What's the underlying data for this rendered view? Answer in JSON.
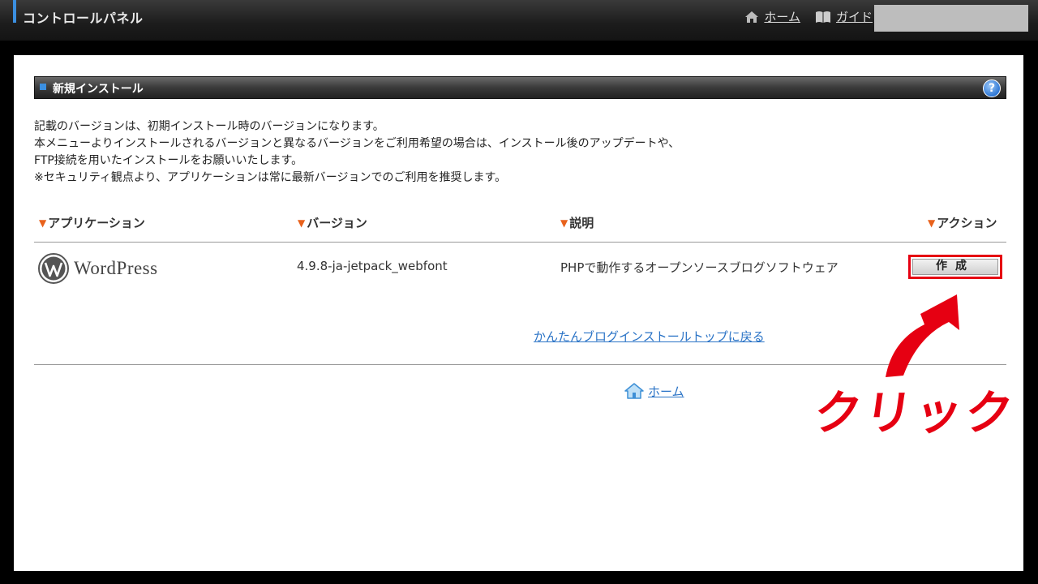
{
  "header": {
    "title": "コントロールパネル",
    "nav": [
      {
        "label": "ホーム",
        "icon": "home-icon"
      },
      {
        "label": "ガイド",
        "icon": "book-icon"
      }
    ]
  },
  "section": {
    "title": "新規インストール",
    "help_label": "?",
    "description": [
      "記載のバージョンは、初期インストール時のバージョンになります。",
      "本メニューよりインストールされるバージョンと異なるバージョンをご利用希望の場合は、インストール後のアップデートや、",
      "FTP接続を用いたインストールをお願いいたします。",
      "※セキュリティ観点より、アプリケーションは常に最新バージョンでのご利用を推奨します。"
    ]
  },
  "table": {
    "sort_marker": "▼",
    "columns": [
      "アプリケーション",
      "バージョン",
      "説明",
      "アクション"
    ],
    "rows": [
      {
        "app_logo_text": "WordPress",
        "version": "4.9.8-ja-jetpack_webfont",
        "description": "PHPで動作するオープンソースブログソフトウェア",
        "action_label": "作成"
      }
    ]
  },
  "links": {
    "back": "かんたんブログインストールトップに戻る",
    "home": "ホーム"
  },
  "annotation": {
    "text": "クリック",
    "color": "#e60012"
  },
  "colors": {
    "accent": "#3b8fe0",
    "link": "#2a73c6",
    "sort_marker": "#e8621c"
  }
}
